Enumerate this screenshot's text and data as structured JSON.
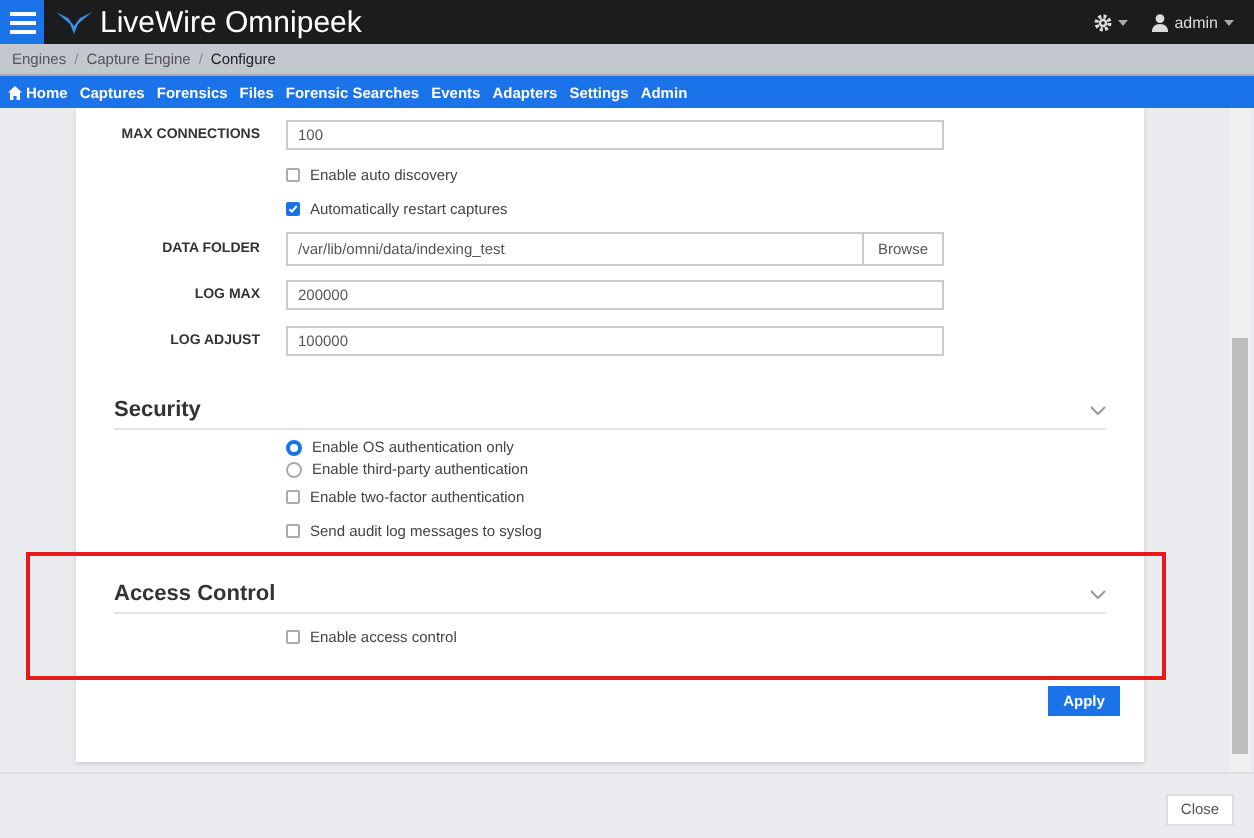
{
  "app": {
    "title": "LiveWire Omnipeek",
    "user": "admin"
  },
  "breadcrumb": [
    {
      "label": "Engines",
      "current": false
    },
    {
      "separator": "/",
      "label": "Capture Engine",
      "current": false
    },
    {
      "separator": "/",
      "label": "Configure",
      "current": true
    }
  ],
  "nav": [
    {
      "label": "Home",
      "kind": "home"
    },
    {
      "label": "Captures"
    },
    {
      "label": "Forensics"
    },
    {
      "label": "Files"
    },
    {
      "label": "Forensic Searches"
    },
    {
      "label": "Events"
    },
    {
      "label": "Adapters"
    },
    {
      "label": "Settings"
    },
    {
      "label": "Admin"
    }
  ],
  "general": [
    {
      "kind": "text",
      "label": "MAX CONNECTIONS",
      "value": "100"
    },
    {
      "kind": "checkbox",
      "label": "Enable auto discovery",
      "checked": false
    },
    {
      "kind": "checkbox",
      "label": "Automatically restart captures",
      "checked": true
    },
    {
      "kind": "folder",
      "label": "DATA FOLDER",
      "value": "/var/lib/omni/data/indexing_test",
      "button": "Browse"
    },
    {
      "kind": "text",
      "label": "LOG MAX",
      "value": "200000"
    },
    {
      "kind": "text",
      "label": "LOG ADJUST",
      "value": "100000"
    }
  ],
  "sections": [
    {
      "title": "Security",
      "highlighted": false,
      "options": [
        {
          "kind": "radio",
          "label": "Enable OS authentication only",
          "selected": true
        },
        {
          "kind": "radio",
          "label": "Enable third-party authentication",
          "selected": false
        },
        {
          "kind": "checkbox",
          "label": "Enable two-factor authentication",
          "checked": false
        },
        {
          "kind": "checkbox",
          "label": "Send audit log messages to syslog",
          "checked": false
        }
      ]
    },
    {
      "title": "Access Control",
      "highlighted": true,
      "options": [
        {
          "kind": "checkbox",
          "label": "Enable access control",
          "checked": false
        }
      ]
    }
  ],
  "apply_button": "Apply",
  "close_button": "Close"
}
